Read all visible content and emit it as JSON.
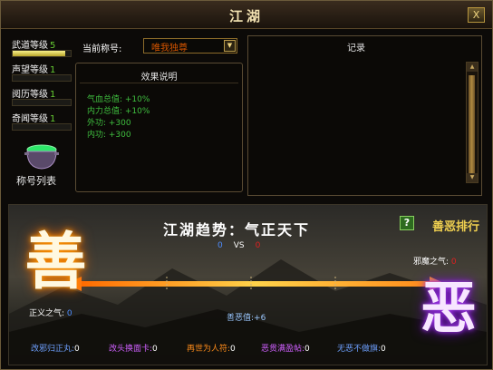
{
  "window": {
    "title": "江湖",
    "close_label": "X"
  },
  "levels": [
    {
      "name": "武道等级",
      "value": "5",
      "fill": 0.9
    },
    {
      "name": "声望等级",
      "value": "1",
      "fill": 0
    },
    {
      "name": "阅历等级",
      "value": "1",
      "fill": 0
    },
    {
      "name": "奇闻等级",
      "value": "1",
      "fill": 0
    }
  ],
  "title_list": {
    "label": "称号列表"
  },
  "current_title": {
    "label": "当前称号:",
    "value": "唯我独尊"
  },
  "effect": {
    "title": "效果说明",
    "items": [
      "气血总值: +10%",
      "内力总值: +10%",
      "外功: +300",
      "内功: +300"
    ]
  },
  "record": {
    "title": "记录"
  },
  "trend": {
    "title": "江湖趋势：气正天下",
    "righteous_value": "0",
    "vs": "VS",
    "evil_value": "0"
  },
  "ranking": {
    "label": "善恶排行",
    "help_icon": "?"
  },
  "good_char": "善",
  "evil_char": "恶",
  "righteous_qi": {
    "label": "正义之气:",
    "value": "0"
  },
  "evil_qi": {
    "label": "邪魔之气:",
    "value": "0"
  },
  "good_evil_value": {
    "label": "善恶值:",
    "value": "+6"
  },
  "bottom_items": [
    {
      "label": "改邪归正丸:",
      "value": "0",
      "color": "#6ea0ff"
    },
    {
      "label": "改头换面卡:",
      "value": "0",
      "color": "#d060ff"
    },
    {
      "label": "再世为人符:",
      "value": "0",
      "color": "#ff8c1a"
    },
    {
      "label": "恶贯满盈帖:",
      "value": "0",
      "color": "#d060ff"
    },
    {
      "label": "无恶不做旗:",
      "value": "0",
      "color": "#6ea0ff"
    }
  ],
  "colors": {
    "accent": "#f0d050",
    "green_text": "#3fbf3f",
    "righteous": "#4d8cff",
    "evil": "#e02020"
  }
}
